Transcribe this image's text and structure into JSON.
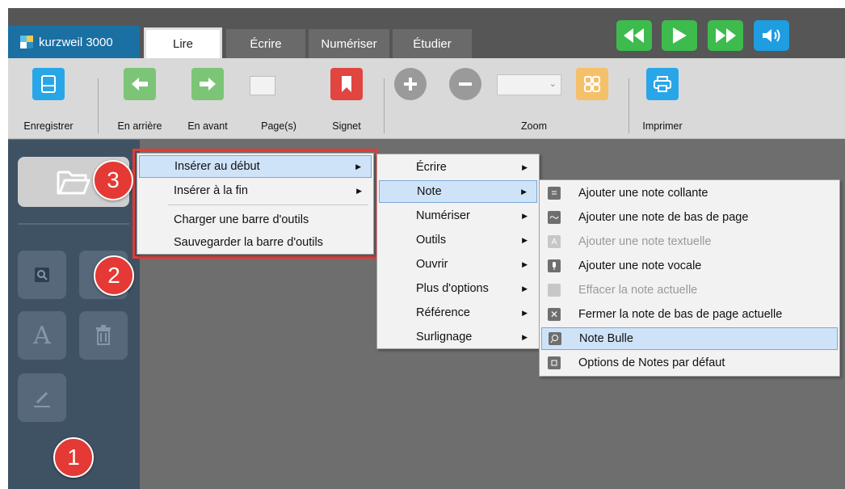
{
  "app": {
    "brand": "kurzweil 3000"
  },
  "tabs": [
    {
      "label": "Lire",
      "active": true
    },
    {
      "label": "Écrire"
    },
    {
      "label": "Numériser"
    },
    {
      "label": "Étudier"
    }
  ],
  "media": {
    "rewind_icon": "rewind-icon",
    "play_icon": "play-icon",
    "fastforward_icon": "fast-forward-icon",
    "volume_icon": "volume-icon"
  },
  "toolbar": {
    "save": "Enregistrer",
    "back": "En arrière",
    "forward": "En avant",
    "pages": "Page(s)",
    "bookmark": "Signet",
    "zoom": "Zoom",
    "print": "Imprimer"
  },
  "badges": [
    "1",
    "2",
    "3"
  ],
  "menu1": {
    "items": [
      "Insérer au début",
      "Insérer à la fin",
      "Charger une barre d'outils",
      "Sauvegarder la barre d'outils"
    ]
  },
  "menu2": {
    "items": [
      "Écrire",
      "Note",
      "Numériser",
      "Outils",
      "Ouvrir",
      "Plus d'options",
      "Référence",
      "Surlignage"
    ]
  },
  "menu3": {
    "items": [
      "Ajouter une note collante",
      "Ajouter une note de bas de page",
      "Ajouter une note textuelle",
      "Ajouter une note vocale",
      "Effacer la note actuelle",
      "Fermer la note de bas de page actuelle",
      "Note Bulle",
      "Options de Notes par défaut"
    ]
  },
  "colors": {
    "green": "#3dbb4c",
    "blue": "#1e9de0",
    "red": "#e53935",
    "brand": "#1a6fa3",
    "panel": "#3e5264",
    "orange": "#f5c06a"
  }
}
